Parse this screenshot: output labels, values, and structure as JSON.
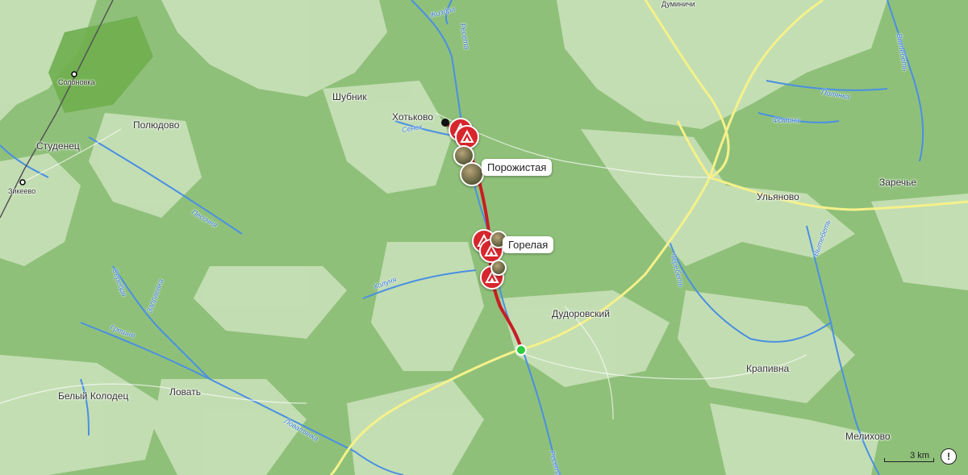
{
  "map": {
    "colors": {
      "forest": "#8fc07a",
      "open_land": "#c6dfb6",
      "river": "#4a90e2",
      "road": "#f5f18a",
      "route": "#c81d25",
      "start_point": "#2ecc40"
    },
    "places": {
      "hotkovo": "Хотьково",
      "shubnik": "Шубник",
      "polyudovo": "Полюдово",
      "studenets": "Студенец",
      "ulyanovo": "Ульяново",
      "zarechye": "Заречье",
      "dudorovsky": "Дудоровский",
      "krapivna": "Крапивна",
      "beliy_kolodets": "Белый Колодец",
      "lovat": "Ловать",
      "melikhovo": "Мелихово",
      "solonovka": "Солоновка",
      "zikeevo": "Зикеево",
      "duminichi": "Думиничи"
    },
    "rivers": {
      "resseta_n": "Ресета",
      "zhizdra": "Жиздра",
      "senek": "Сенек",
      "pesochnya": "Песочня",
      "kholunya": "Холуня",
      "serebrya": "Серебря",
      "zapraevka": "Запраевка",
      "greshnya": "Грешня",
      "lovatyanka": "Ловатянка",
      "resseta_s": "Ресета",
      "polyanka": "Полянка",
      "fomina": "Фомина",
      "vytebet_n": "Вытебеть",
      "vytebet_e": "Вытебеть",
      "chereben": "Черебеть"
    },
    "poi": {
      "porozhistaya": "Порожистая",
      "gorelaya": "Горелая"
    },
    "icons": {
      "campsite": "campsite-icon",
      "photo": "photo-thumbnail-icon",
      "info": "info-icon"
    },
    "scale_label": "3 km",
    "info_label": "!"
  }
}
